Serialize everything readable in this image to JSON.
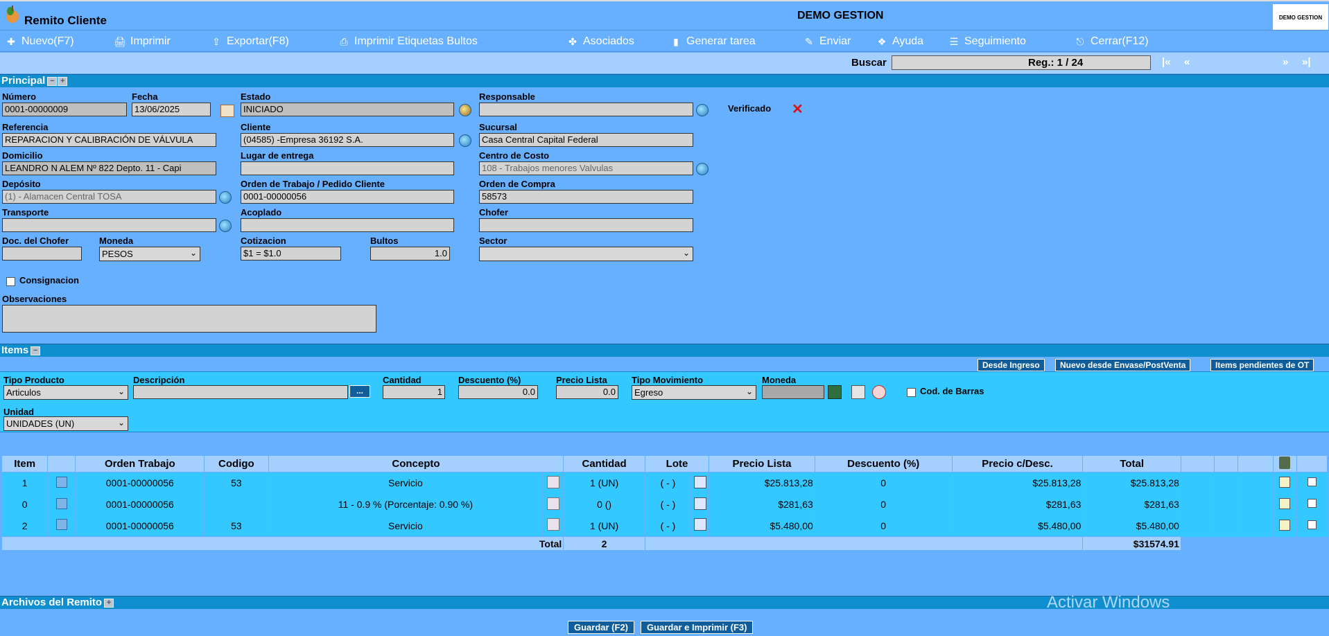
{
  "window": {
    "title": "Remito Cliente",
    "company": "DEMO GESTION",
    "logo_text": "DEMO GESTION"
  },
  "toolbar": [
    {
      "label": "Nuevo(F7)",
      "icon": "add-icon"
    },
    {
      "label": "Imprimir",
      "icon": "print-icon"
    },
    {
      "label": "Exportar(F8)",
      "icon": "export-icon"
    },
    {
      "label": "Imprimir Etiquetas Bultos",
      "icon": "labels-icon"
    },
    {
      "label": "Asociados",
      "icon": "associates-icon"
    },
    {
      "label": "Generar tarea",
      "icon": "task-icon"
    },
    {
      "label": "Enviar",
      "icon": "send-icon"
    },
    {
      "label": "Ayuda",
      "icon": "help-icon"
    },
    {
      "label": "Seguimiento",
      "icon": "tracking-icon"
    },
    {
      "label": "Cerrar(F12)",
      "icon": "close-icon"
    }
  ],
  "search": {
    "label": "Buscar",
    "value": "",
    "first": "|«",
    "prev": "«",
    "reg": "Reg.: 1 / 24",
    "next": "»",
    "last": "»|"
  },
  "principal": {
    "section_title": "Principal",
    "numero": {
      "label": "Número",
      "value": "0001-00000009"
    },
    "fecha": {
      "label": "Fecha",
      "value": "13/06/2025"
    },
    "estado": {
      "label": "Estado",
      "value": "INICIADO"
    },
    "responsable": {
      "label": "Responsable",
      "value": ""
    },
    "verificado": {
      "label": "Verificado"
    },
    "referencia": {
      "label": "Referencia",
      "value": "REPARACION Y CALIBRACIÓN DE VÁLVULA"
    },
    "cliente": {
      "label": "Cliente",
      "value": "(04585) -Empresa 36192 S.A."
    },
    "sucursal": {
      "label": "Sucursal",
      "value": "Casa Central Capital Federal"
    },
    "domicilio": {
      "label": "Domicilio",
      "value": "LEANDRO N ALEM  Nº 822 Depto. 11 - Capi"
    },
    "lugar_entrega": {
      "label": "Lugar de entrega",
      "value": ""
    },
    "centro_costo": {
      "label": "Centro de Costo",
      "value": "108 - Trabajos menores Valvulas"
    },
    "deposito": {
      "label": "Depósito",
      "value": "(1) - Alamacen Central TOSA"
    },
    "orden_trabajo": {
      "label": "Orden de Trabajo / Pedido Cliente",
      "value": "0001-00000056"
    },
    "orden_compra": {
      "label": "Orden de Compra",
      "value": "58573"
    },
    "transporte": {
      "label": "Transporte",
      "value": ""
    },
    "acoplado": {
      "label": "Acoplado",
      "value": ""
    },
    "chofer": {
      "label": "Chofer",
      "value": ""
    },
    "doc_chofer": {
      "label": "Doc. del Chofer",
      "value": ""
    },
    "moneda": {
      "label": "Moneda",
      "value": "PESOS"
    },
    "cotizacion": {
      "label": "Cotizacion",
      "value": "$1 = $1.0"
    },
    "bultos": {
      "label": "Bultos",
      "value": "1.0"
    },
    "sector": {
      "label": "Sector",
      "value": ""
    },
    "consignacion": {
      "label": "Consignacion"
    },
    "observaciones": {
      "label": "Observaciones",
      "value": ""
    }
  },
  "items": {
    "section_title": "Items",
    "header_buttons": [
      "Desde Ingreso",
      "Nuevo desde Envase/PostVenta",
      "Items pendientes de OT"
    ],
    "form": {
      "tipo_producto": {
        "label": "Tipo Producto",
        "value": "Articulos"
      },
      "descripcion": {
        "label": "Descripción",
        "value": "",
        "btn": "..."
      },
      "cantidad": {
        "label": "Cantidad",
        "value": "1"
      },
      "descuento": {
        "label": "Descuento (%)",
        "value": "0.0"
      },
      "precio_lista": {
        "label": "Precio Lista",
        "value": "0.0"
      },
      "tipo_movimiento": {
        "label": "Tipo Movimiento",
        "value": "Egreso"
      },
      "moneda": {
        "label": "Moneda",
        "value": ""
      },
      "cod_barras": {
        "label": "Cod. de Barras"
      },
      "unidad": {
        "label": "Unidad",
        "value": "UNIDADES (UN)"
      }
    },
    "columns": [
      "Item",
      "",
      "Orden Trabajo",
      "Codigo",
      "Concepto",
      "",
      "Cantidad",
      "Lote",
      "",
      "Precio Lista",
      "Descuento (%)",
      "Precio c/Desc.",
      "Total",
      "",
      "",
      "",
      "",
      ""
    ],
    "rows": [
      {
        "item": "1",
        "orden": "0001-00000056",
        "codigo": "53",
        "concepto": "Servicio",
        "cantidad": "1 (UN)",
        "lote": "( - )",
        "precio_lista": "$25.813,28",
        "descuento": "0",
        "precio_desc": "$25.813,28",
        "total": "$25.813,28"
      },
      {
        "item": "0",
        "orden": "0001-00000056",
        "codigo": "",
        "concepto": "11 - 0.9 % (Porcentaje: 0.90 %)",
        "cantidad": "0 ()",
        "lote": "( - )",
        "precio_lista": "$281,63",
        "descuento": "0",
        "precio_desc": "$281,63",
        "total": "$281,63"
      },
      {
        "item": "2",
        "orden": "0001-00000056",
        "codigo": "53",
        "concepto": "Servicio",
        "cantidad": "1 (UN)",
        "lote": "( - )",
        "precio_lista": "$5.480,00",
        "descuento": "0",
        "precio_desc": "$5.480,00",
        "total": "$5.480,00"
      }
    ],
    "total_label": "Total",
    "total_cantidad": "2",
    "total_amount": "$31574.91"
  },
  "archivos": {
    "section_title": "Archivos del Remito"
  },
  "footer": {
    "guardar": "Guardar (F2)",
    "guardar_imprimir": "Guardar e Imprimir (F3)"
  },
  "watermark": "Activar Windows"
}
